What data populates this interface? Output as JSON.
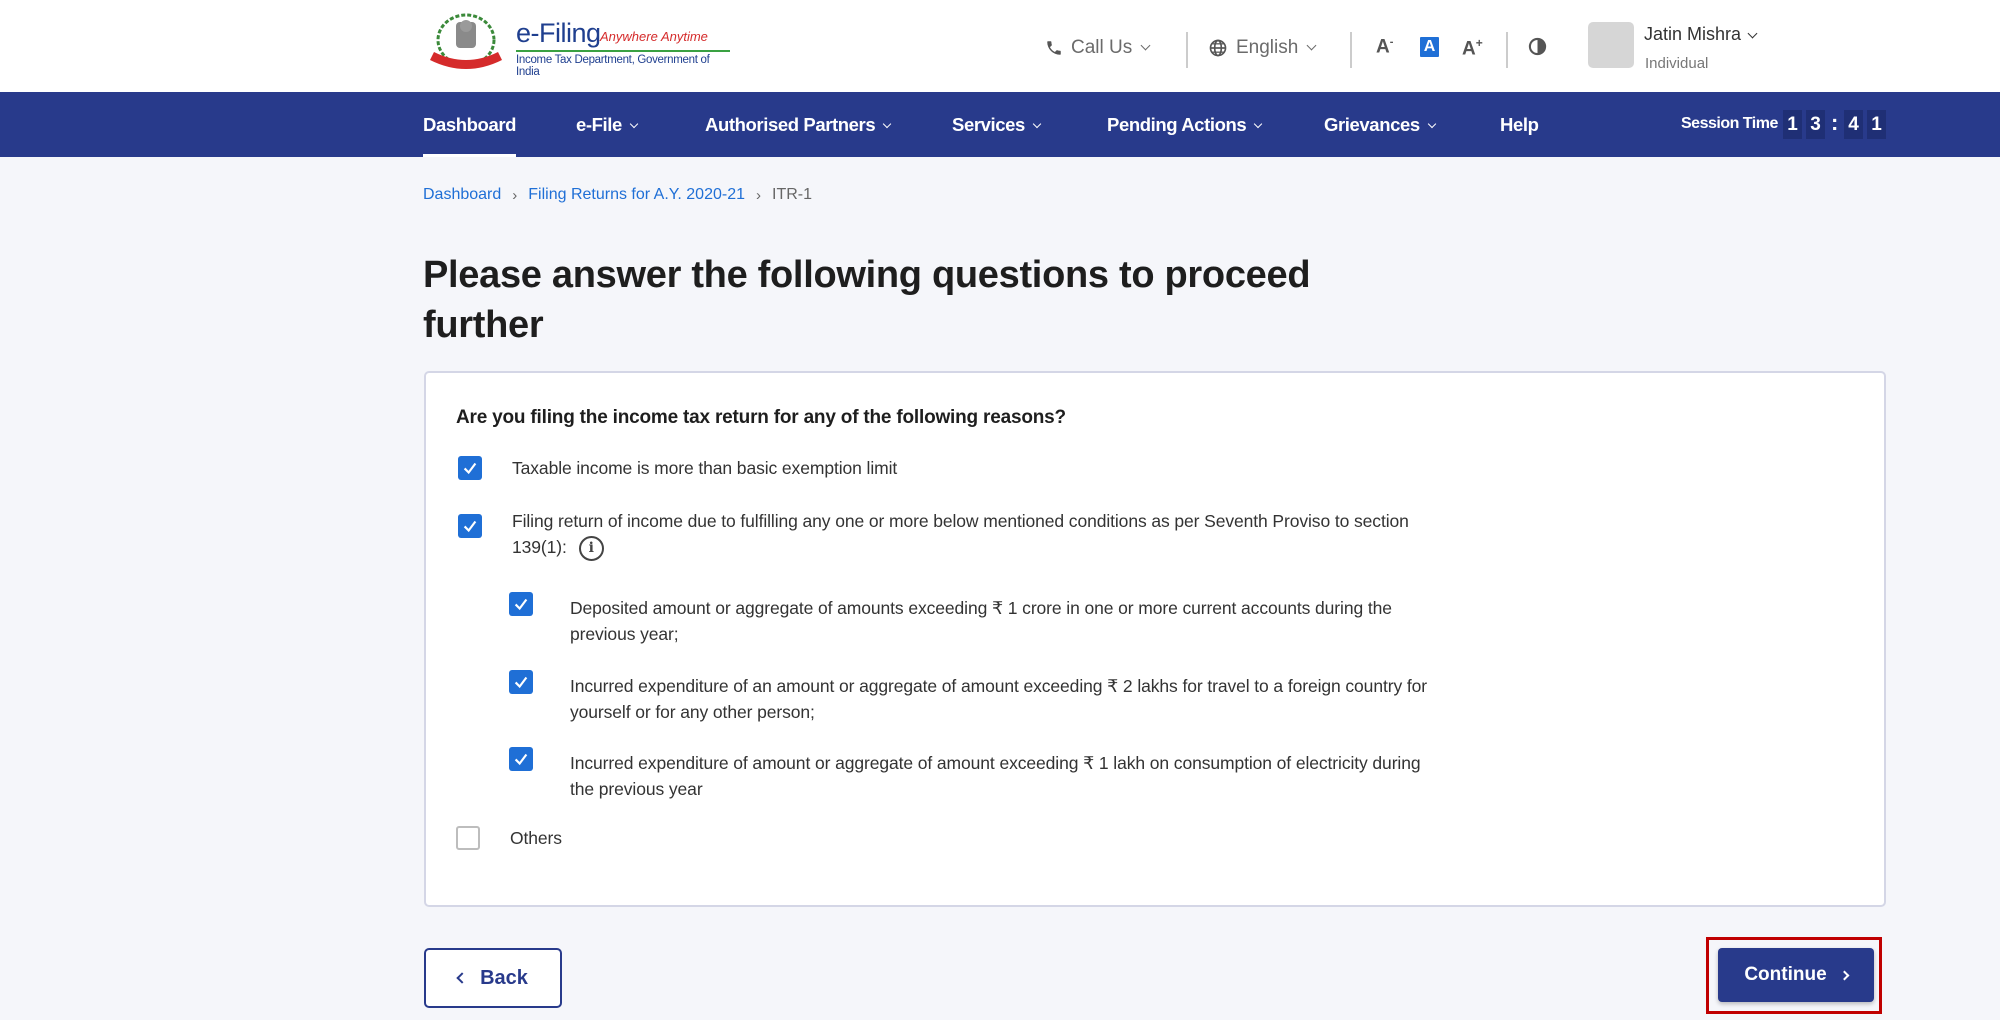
{
  "header": {
    "logo": {
      "title": "e-Filing",
      "tagline": "Anywhere Anytime",
      "subtitle": "Income Tax Department, Government of India"
    },
    "call_us": {
      "label": "Call Us",
      "icon": "phone-icon"
    },
    "language": {
      "label": "English",
      "icon": "globe-icon"
    },
    "font_controls": [
      {
        "label": "A",
        "suffix": "-",
        "name": "decrease-font"
      },
      {
        "label": "A",
        "suffix": "",
        "name": "default-font",
        "active": true
      },
      {
        "label": "A",
        "suffix": "+",
        "name": "increase-font"
      }
    ],
    "contrast_icon": "contrast-icon",
    "user": {
      "name": "Jatin Mishra",
      "role": "Individual"
    }
  },
  "nav": {
    "items": [
      {
        "label": "Dashboard",
        "active": true,
        "dropdown": false
      },
      {
        "label": "e-File",
        "dropdown": true
      },
      {
        "label": "Authorised Partners",
        "dropdown": true
      },
      {
        "label": "Services",
        "dropdown": true
      },
      {
        "label": "Pending Actions",
        "dropdown": true
      },
      {
        "label": "Grievances",
        "dropdown": true
      },
      {
        "label": "Help",
        "dropdown": false
      }
    ],
    "session": {
      "label": "Session Time",
      "digits": [
        "1",
        "3",
        "4",
        "1"
      ],
      "separator": ":"
    }
  },
  "breadcrumb": {
    "items": [
      "Dashboard",
      "Filing Returns for A.Y. 2020-21"
    ],
    "current": "ITR-1",
    "separator": "›"
  },
  "page": {
    "title": "Please answer the following questions to proceed further"
  },
  "form": {
    "question": "Are you filing the income tax return for any of the following reasons?",
    "options": [
      {
        "label": "Taxable income is more than basic exemption limit",
        "checked": true
      },
      {
        "label": "Filing return of income due to fulfilling any one or more below mentioned conditions as per Seventh Proviso to section 139(1):",
        "checked": true,
        "info_icon": "i"
      },
      {
        "label": "Deposited amount or aggregate of amounts exceeding ₹ 1 crore in one or more current accounts during the previous year;",
        "checked": true,
        "sub": true
      },
      {
        "label": "Incurred expenditure of an amount or aggregate of amount exceeding ₹ 2 lakhs for travel to a foreign country for yourself or for any other person;",
        "checked": true,
        "sub": true
      },
      {
        "label": "Incurred expenditure of amount or aggregate of amount exceeding ₹ 1 lakh on consumption of electricity during the previous year",
        "checked": true,
        "sub": true
      },
      {
        "label": "Others",
        "checked": false
      }
    ]
  },
  "actions": {
    "back_label": "Back",
    "continue_label": "Continue"
  },
  "colors": {
    "primary": "#283a8b",
    "checkbox": "#1f6fd6",
    "link": "#1f6fd6",
    "highlight": "#c00000"
  }
}
